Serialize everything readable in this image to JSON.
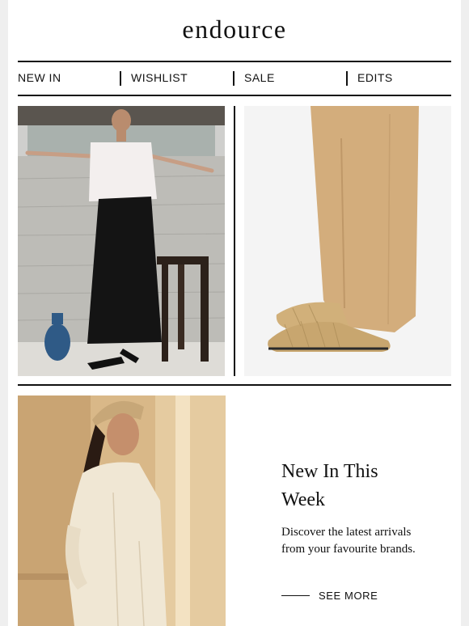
{
  "brand": {
    "logo_text": "endource"
  },
  "nav": {
    "items": [
      "NEW IN",
      "WISHLIST",
      "SALE",
      "EDITS"
    ]
  },
  "images": {
    "hero_left": "model-white-shirt-black-skirt",
    "hero_right": "woven-mules-beige-trousers",
    "promo": "model-headscarf-cream-outfit"
  },
  "promo": {
    "title_line1": "New In This",
    "title_line2": "Week",
    "body": "Discover the latest arrivals from your favourite brands.",
    "cta_label": "SEE MORE"
  }
}
